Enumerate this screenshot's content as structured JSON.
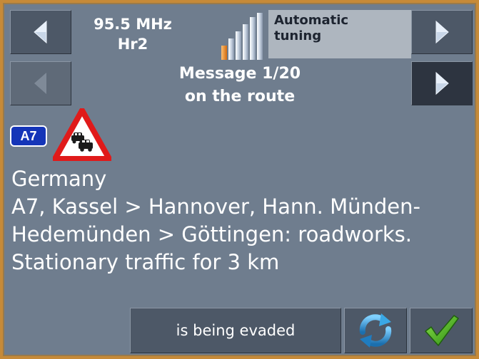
{
  "radio": {
    "frequency": "95.5 MHz",
    "station": "Hr2",
    "signal_level": 0.8,
    "tuning_line1": "Automatic",
    "tuning_line2": "tuning"
  },
  "message": {
    "line1": "Message 1/20",
    "line2": "on the route"
  },
  "road": {
    "badge": "A7"
  },
  "description": {
    "line1": "Germany",
    "line2": "A7, Kassel > Hannover, Hann. Münden-",
    "line3": "Hedemünden > Göttingen:  roadworks.",
    "line4": "Stationary traffic for 3 km"
  },
  "actions": {
    "evade_label": "is being evaded"
  },
  "icons": {
    "prev_station": "arrow-left-icon",
    "next_station": "arrow-right-icon",
    "prev_message": "arrow-left-icon",
    "next_message": "arrow-right-icon",
    "warning": "traffic-jam-warning-icon",
    "refresh": "refresh-icon",
    "confirm": "checkmark-icon"
  },
  "colors": {
    "background": "#6f7d8e",
    "button": "#4d5867",
    "road_badge": "#1535b8",
    "warning_red": "#e01a1a",
    "confirm_green": "#3fa018",
    "refresh_blue": "#2a8ecf",
    "signal_orange": "#e08a2a"
  }
}
